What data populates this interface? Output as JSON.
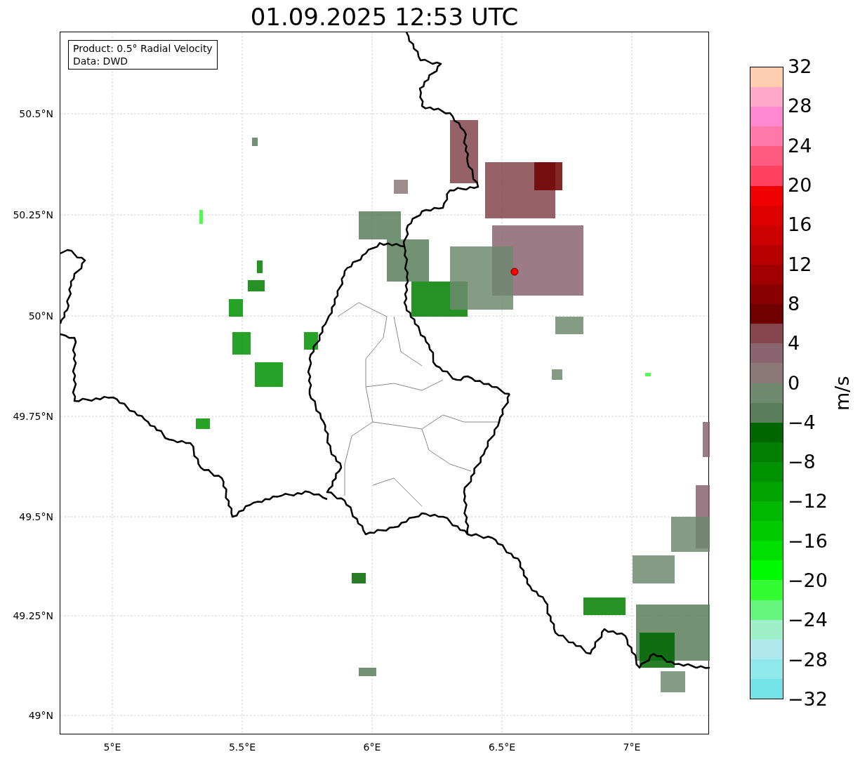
{
  "title": "01.09.2025 12:53 UTC",
  "map": {
    "legend": [
      "Product: 0.5° Radial Velocity",
      "Data: DWD"
    ],
    "x_ticks": [
      "5°E",
      "5.5°E",
      "6°E",
      "6.5°E",
      "7°E"
    ],
    "y_ticks": [
      "50.5°N",
      "50.25°N",
      "50°N",
      "49.75°N",
      "49.5°N",
      "49.25°N",
      "49°N"
    ]
  },
  "colorbar": {
    "label": "m/s",
    "ticks": [
      "32",
      "28",
      "24",
      "20",
      "16",
      "12",
      "8",
      "4",
      "0",
      "−4",
      "−8",
      "−12",
      "−16",
      "−20",
      "−24",
      "−28",
      "−32"
    ],
    "segments": [
      {
        "color": "#ffcdb0"
      },
      {
        "color": "#ffa8c8"
      },
      {
        "color": "#ff88d0"
      },
      {
        "color": "#ff78a8"
      },
      {
        "color": "#ff5a80"
      },
      {
        "color": "#ff4060"
      },
      {
        "color": "#f00000"
      },
      {
        "color": "#dd0000"
      },
      {
        "color": "#cc0000"
      },
      {
        "color": "#b80000"
      },
      {
        "color": "#a00000"
      },
      {
        "color": "#880000"
      },
      {
        "color": "#700000"
      },
      {
        "color": "#84464c"
      },
      {
        "color": "#8a6470"
      },
      {
        "color": "#8c7878"
      },
      {
        "color": "#6f8a6f"
      },
      {
        "color": "#5a7e5a"
      },
      {
        "color": "#006600"
      },
      {
        "color": "#007f00"
      },
      {
        "color": "#009200"
      },
      {
        "color": "#00a300"
      },
      {
        "color": "#00b800"
      },
      {
        "color": "#00cc00"
      },
      {
        "color": "#00e000"
      },
      {
        "color": "#00fa00"
      },
      {
        "color": "#33fc33"
      },
      {
        "color": "#66f57f"
      },
      {
        "color": "#9ef0c8"
      },
      {
        "color": "#aee8ec"
      },
      {
        "color": "#8fe8ea"
      },
      {
        "color": "#74e3e8"
      }
    ]
  }
}
